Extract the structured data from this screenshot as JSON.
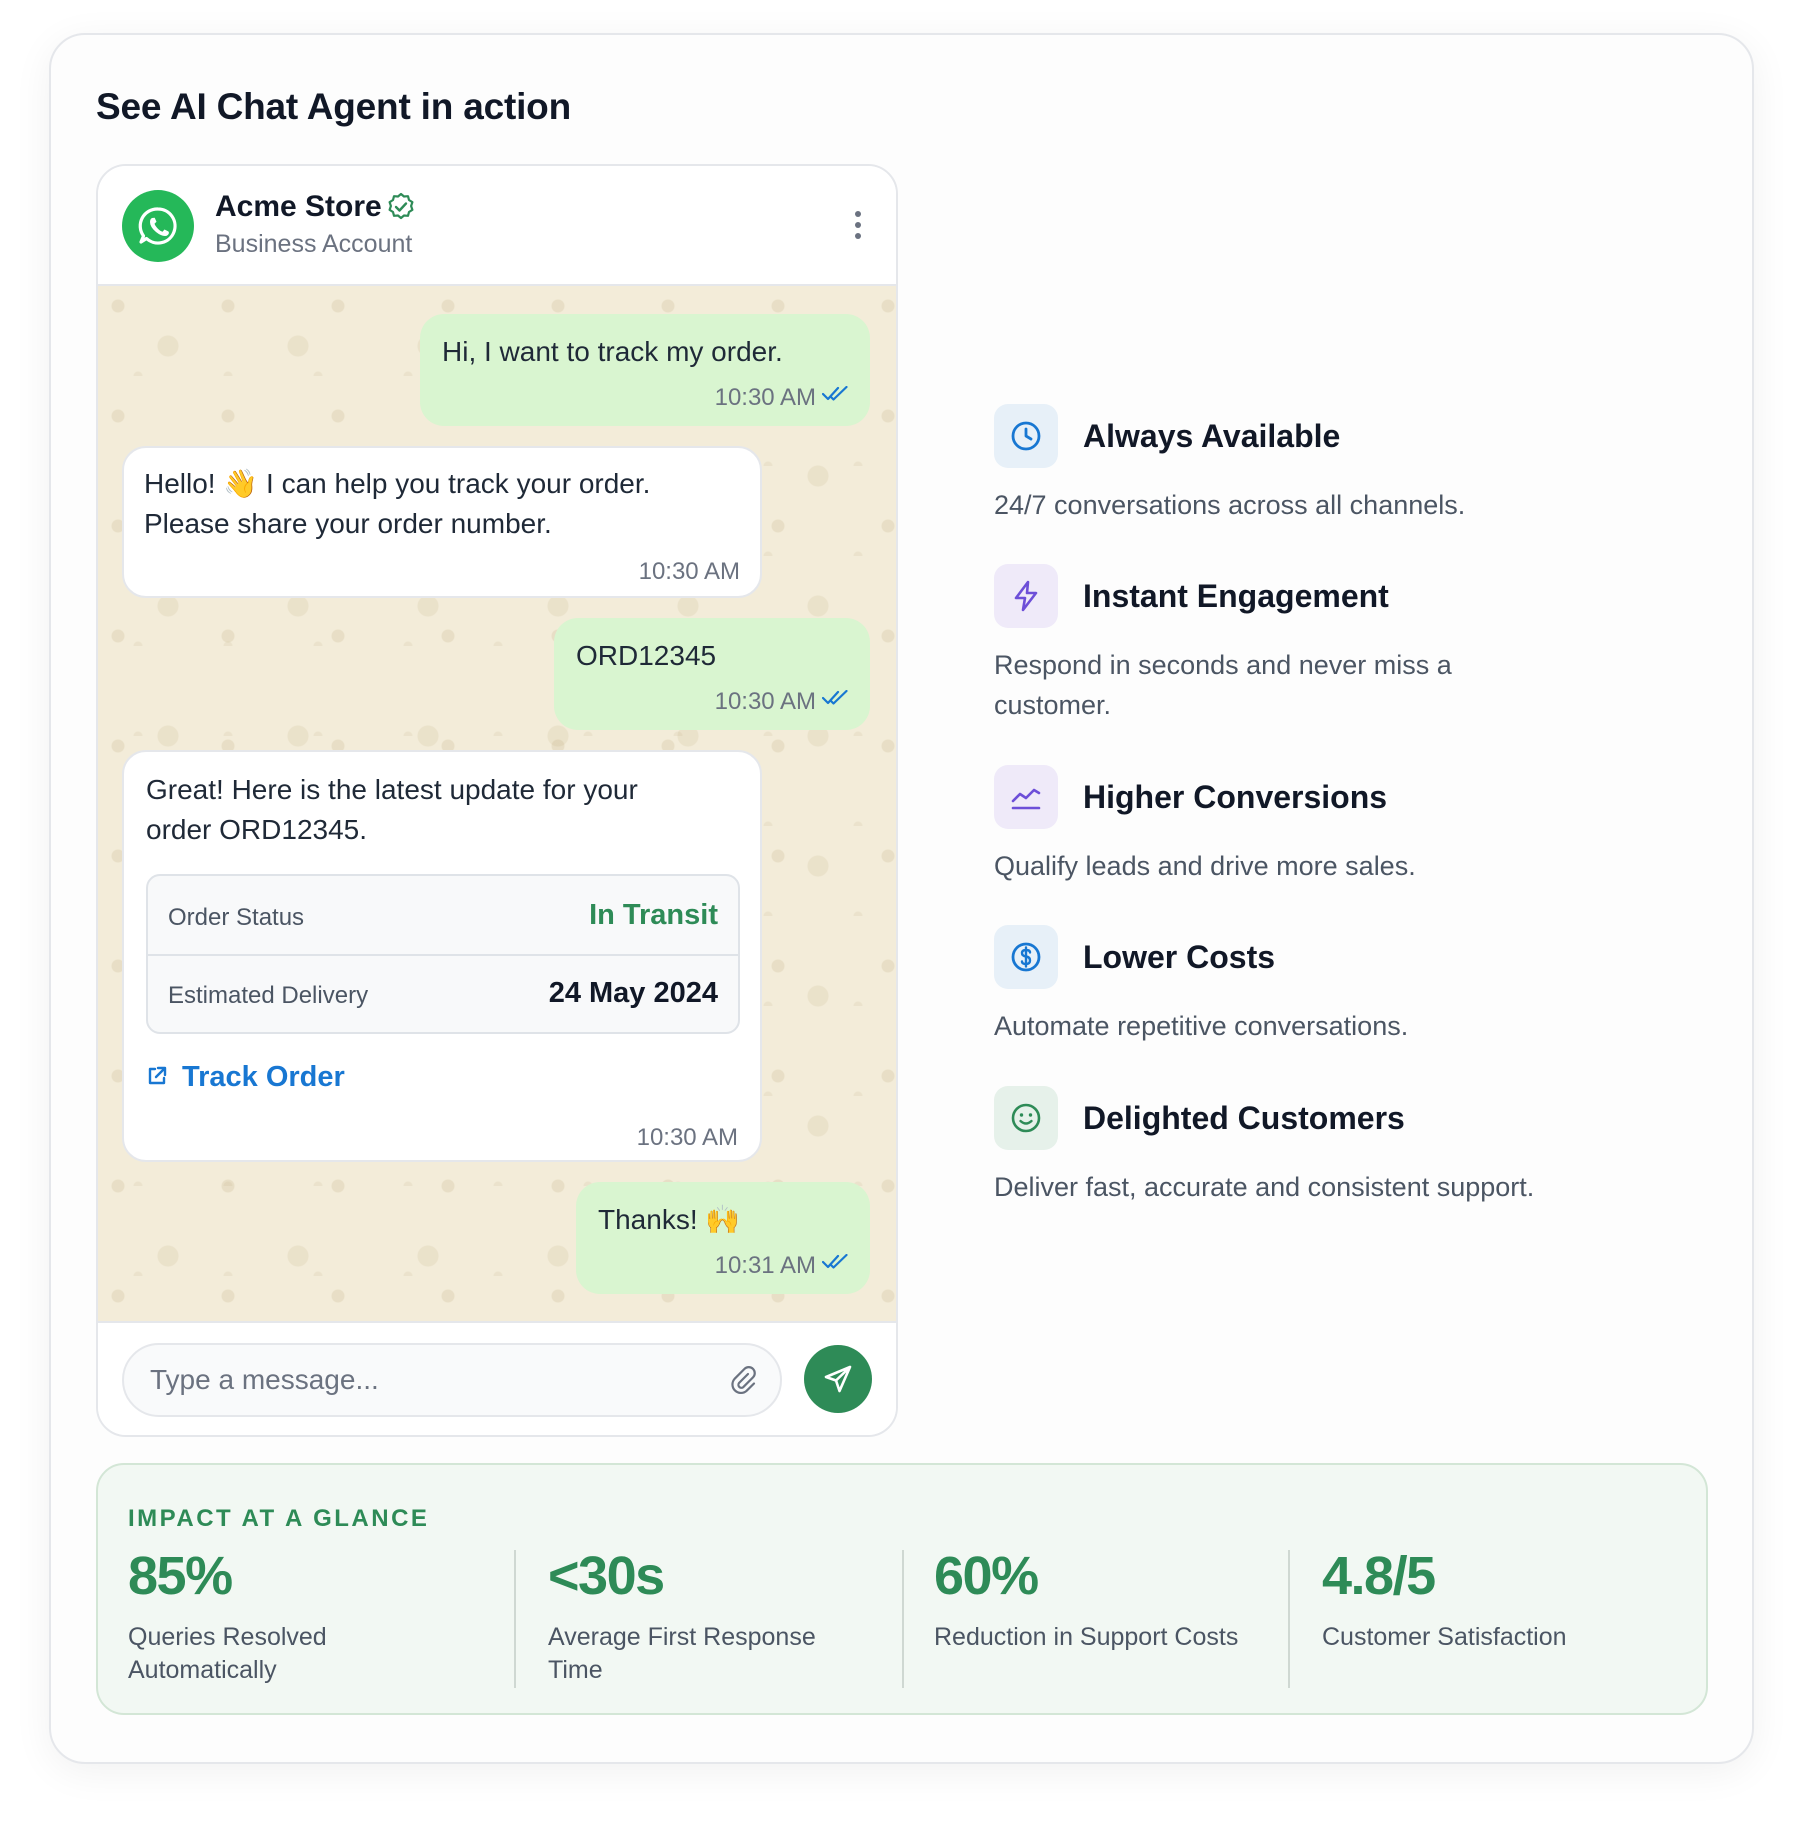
{
  "page": {
    "heading": "See AI Chat Agent in action"
  },
  "chat": {
    "store_name": "Acme Store",
    "account_type": "Business Account",
    "messages": [
      {
        "direction": "out",
        "text": "Hi, I want to track my order.",
        "time": "10:30 AM",
        "read": true
      },
      {
        "direction": "in",
        "line1": "Hello! 👋 I can help you track your order.",
        "line2": "Please share your order number.",
        "time": "10:30 AM"
      },
      {
        "direction": "out",
        "text": "ORD12345",
        "time": "10:30 AM",
        "read": true
      },
      {
        "direction": "in",
        "line1": "Great! Here is the latest update for your",
        "line2": "order ORD12345.",
        "time": "10:30 AM",
        "card": {
          "status_label": "Order Status",
          "status_value": "In Transit",
          "delivery_label": "Estimated Delivery",
          "delivery_value": "24 May 2024",
          "link_label": "Track Order"
        }
      },
      {
        "direction": "out",
        "text": "Thanks! 🙌",
        "time": "10:31 AM",
        "read": true
      }
    ],
    "composer": {
      "placeholder": "Type a message..."
    }
  },
  "features": [
    {
      "icon": "clock-icon",
      "title": "Always Available",
      "desc": "24/7 conversations across all channels.",
      "color": "#1877d2",
      "bg": "#e7f0f8"
    },
    {
      "icon": "bolt-icon",
      "title": "Instant Engagement",
      "desc": "Respond in seconds and never miss a customer.",
      "color": "#6d4fd8",
      "bg": "#efeaf9"
    },
    {
      "icon": "chart-line-icon",
      "title": "Higher Conversions",
      "desc": "Qualify leads and drive more sales.",
      "color": "#6d4fd8",
      "bg": "#efeaf9"
    },
    {
      "icon": "dollar-icon",
      "title": "Lower Costs",
      "desc": "Automate repetitive conversations.",
      "color": "#1877d2",
      "bg": "#e7f0f8"
    },
    {
      "icon": "smile-icon",
      "title": "Delighted Customers",
      "desc": "Deliver fast, accurate and consistent support.",
      "color": "#2e8b57",
      "bg": "#e6f1ea"
    }
  ],
  "impact": {
    "title": "IMPACT AT A GLANCE",
    "stats": [
      {
        "value": "85%",
        "label": "Queries Resolved Automatically"
      },
      {
        "value": "<30s",
        "label": "Average First Response Time"
      },
      {
        "value": "60%",
        "label": "Reduction in Support Costs"
      },
      {
        "value": "4.8/5",
        "label": "Customer Satisfaction"
      }
    ]
  },
  "colors": {
    "accent_green": "#2e8b57",
    "whatsapp_green": "#25b859",
    "link_blue": "#1877d2",
    "read_tick": "#1877d2"
  }
}
